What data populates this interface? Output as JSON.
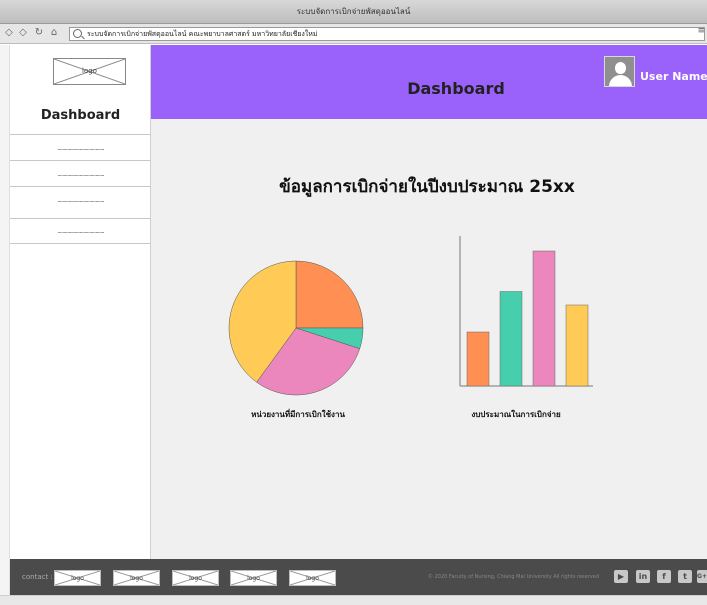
{
  "window": {
    "title": "ระบบจัดการเบิกจ่ายพัสดุออนไลน์",
    "url": "ระบบจัดการเบิกจ่ายพัสดุออนไลน์ คณะพยาบาลศาสตร์ มหาวิทยาลัยเชียงใหม่"
  },
  "sidebar": {
    "logo": "logo",
    "title": "Dashboard",
    "items": [
      {
        "label": "......................................"
      },
      {
        "label": "......................................"
      },
      {
        "label": "......................................"
      },
      {
        "label": "......................................"
      }
    ]
  },
  "header": {
    "title": "Dashboard",
    "user_name": "User Name"
  },
  "main": {
    "title": "ข้อมูลการเบิกจ่ายในปีงบประมาณ 25xx",
    "pie_label": "หน่วยงานที่มีการเบิกใช้งาน",
    "bar_label": "งบประมาณในการเบิกจ่าย"
  },
  "chart_data": [
    {
      "type": "pie",
      "title": "",
      "slices": [
        {
          "value": 25,
          "color": "#ff8f52"
        },
        {
          "value": 5,
          "color": "#47cfad"
        },
        {
          "value": 30,
          "color": "#eb87bd"
        },
        {
          "value": 40,
          "color": "#ffca55"
        }
      ]
    },
    {
      "type": "bar",
      "title": "",
      "categories": [
        "",
        "",
        "",
        ""
      ],
      "values": [
        36,
        63,
        90,
        54
      ],
      "colors": [
        "#ff8f52",
        "#47cfad",
        "#eb87bd",
        "#ffca55"
      ],
      "ylim": [
        0,
        100
      ],
      "xlabel": "",
      "ylabel": ""
    }
  ],
  "footer": {
    "contact": "contact :",
    "logos": [
      "logo",
      "logo",
      "logo",
      "logo",
      "logo"
    ],
    "copyright": "© 2020 Faculty of Nursing, Chiang Mai University All rights reserved",
    "social": [
      {
        "icon": "youtube-icon",
        "glyph": "▶"
      },
      {
        "icon": "linkedin-icon",
        "glyph": "in"
      },
      {
        "icon": "facebook-icon",
        "glyph": "f"
      },
      {
        "icon": "twitter-icon",
        "glyph": "t"
      },
      {
        "icon": "google-plus-icon",
        "glyph": "G+"
      }
    ]
  }
}
